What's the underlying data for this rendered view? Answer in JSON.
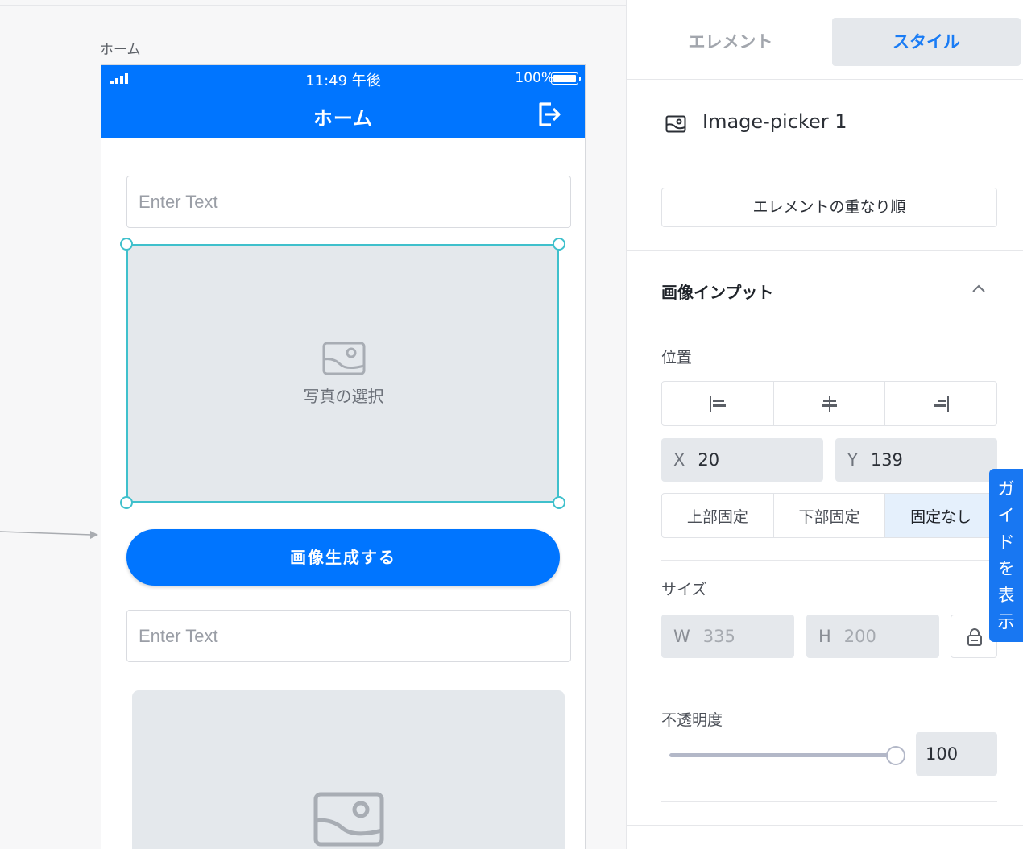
{
  "canvas": {
    "screen_label": "ホーム",
    "phone": {
      "status_time": "11:49 午後",
      "battery_text": "100%",
      "nav_title": "ホーム",
      "input1_placeholder": "Enter Text",
      "picker1_label": "写真の選択",
      "generate_button": "画像生成する",
      "input2_placeholder": "Enter Text"
    }
  },
  "panel": {
    "tabs": [
      "エレメント",
      "スタイル"
    ],
    "active_tab": "スタイル",
    "element_name": "Image-picker 1",
    "order_button": "エレメントの重なり順",
    "section_title": "画像インプット",
    "position_label": "位置",
    "x_key": "X",
    "x_value": "20",
    "y_key": "Y",
    "y_value": "139",
    "anchor_options": [
      "上部固定",
      "下部固定",
      "固定なし"
    ],
    "anchor_selected": "固定なし",
    "size_label": "サイズ",
    "w_key": "W",
    "w_value": "335",
    "h_key": "H",
    "h_value": "200",
    "opacity_label": "不透明度",
    "opacity_value": "100",
    "guide_tab": [
      "ガ",
      "イ",
      "ド",
      "を",
      "表",
      "示"
    ]
  },
  "colors": {
    "brand_blue": "#0075ff",
    "selection": "#3fc0cc",
    "panel_accent": "#1a7cf5"
  }
}
